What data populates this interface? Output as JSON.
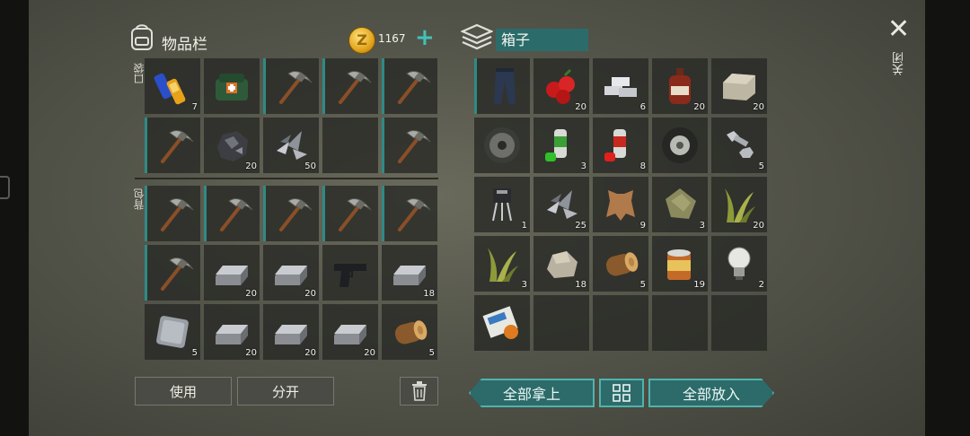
{
  "inventory": {
    "title": "物品栏",
    "coins": "1167",
    "add_label": "+",
    "pocket_label": "口袋",
    "backpack_label": "背包",
    "use_label": "使用",
    "split_label": "分开",
    "trash_icon": "trash-icon",
    "pockets": [
      {
        "icon": "batteries",
        "count": "7"
      },
      {
        "icon": "first-aid-pack",
        "count": ""
      },
      {
        "icon": "pickaxe",
        "count": ""
      },
      {
        "icon": "pickaxe",
        "count": ""
      },
      {
        "icon": "pickaxe",
        "count": ""
      },
      {
        "icon": "pickaxe",
        "count": ""
      },
      {
        "icon": "ore",
        "count": "20"
      },
      {
        "icon": "metal-scraps",
        "count": "50"
      },
      {
        "icon": "empty",
        "count": ""
      },
      {
        "icon": "pickaxe",
        "count": ""
      }
    ],
    "backpack": [
      {
        "icon": "pickaxe",
        "count": ""
      },
      {
        "icon": "pickaxe",
        "count": ""
      },
      {
        "icon": "pickaxe",
        "count": ""
      },
      {
        "icon": "pickaxe",
        "count": ""
      },
      {
        "icon": "pickaxe",
        "count": ""
      },
      {
        "icon": "pickaxe",
        "count": ""
      },
      {
        "icon": "iron-ingot",
        "count": "20"
      },
      {
        "icon": "iron-ingot",
        "count": "20"
      },
      {
        "icon": "pistol",
        "count": ""
      },
      {
        "icon": "iron-ingot",
        "count": "18"
      },
      {
        "icon": "metal-plate",
        "count": "5"
      },
      {
        "icon": "iron-ingot",
        "count": "20"
      },
      {
        "icon": "iron-ingot",
        "count": "20"
      },
      {
        "icon": "iron-ingot",
        "count": "20"
      },
      {
        "icon": "wood-log",
        "count": "5"
      }
    ]
  },
  "chest": {
    "name": "箱子",
    "take_all_label": "全部拿上",
    "put_all_label": "全部放入",
    "sort_icon": "grid-sort-icon",
    "items": [
      {
        "icon": "pants",
        "count": ""
      },
      {
        "icon": "berries",
        "count": "20"
      },
      {
        "icon": "aluminum-bars",
        "count": "6"
      },
      {
        "icon": "bottle",
        "count": "20"
      },
      {
        "icon": "stone-block",
        "count": "20"
      },
      {
        "icon": "disc-wheel",
        "count": ""
      },
      {
        "icon": "spray-can-green",
        "count": "3"
      },
      {
        "icon": "spray-can-red",
        "count": "8"
      },
      {
        "icon": "tire",
        "count": ""
      },
      {
        "icon": "bolt-nut",
        "count": "5"
      },
      {
        "icon": "transistor",
        "count": "1"
      },
      {
        "icon": "metal-scraps",
        "count": "25"
      },
      {
        "icon": "leather",
        "count": "9"
      },
      {
        "icon": "cloth",
        "count": "3"
      },
      {
        "icon": "plant-fiber",
        "count": "20"
      },
      {
        "icon": "plant-fiber",
        "count": "3"
      },
      {
        "icon": "stone",
        "count": "18"
      },
      {
        "icon": "wood-log",
        "count": "5"
      },
      {
        "icon": "tin-can",
        "count": "19"
      },
      {
        "icon": "light-bulb",
        "count": "2"
      },
      {
        "icon": "newspaper",
        "count": ""
      },
      {
        "icon": "empty",
        "count": ""
      },
      {
        "icon": "empty",
        "count": ""
      },
      {
        "icon": "empty",
        "count": ""
      },
      {
        "icon": "empty",
        "count": ""
      }
    ]
  },
  "close_label": "关闭",
  "colors": {
    "accent": "#2f8a85",
    "teal_button": "#2c6b6a",
    "panel": "#57584d"
  }
}
